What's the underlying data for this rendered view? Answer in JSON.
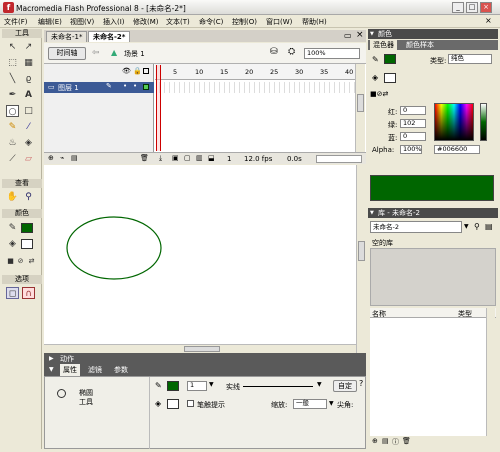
{
  "window": {
    "title": "Macromedia Flash Professional 8 - [未命名-2*]"
  },
  "menu": [
    "文件(F)",
    "编辑(E)",
    "视图(V)",
    "插入(I)",
    "修改(M)",
    "文本(T)",
    "命令(C)",
    "控制(O)",
    "窗口(W)",
    "帮助(H)"
  ],
  "toolbox": {
    "title": "工具",
    "view_label": "查看",
    "color_label": "颜色",
    "options_label": "选项"
  },
  "tabs": [
    "未命名-1*",
    "未命名-2*"
  ],
  "scene": {
    "timeline_button": "时间轴",
    "scene_label": "场景 1",
    "zoom": "100%"
  },
  "timeline": {
    "layer_name": "图层 1",
    "frame_numbers": [
      "5",
      "10",
      "15",
      "20",
      "25",
      "30",
      "35",
      "40"
    ],
    "current_frame": "1",
    "fps": "12.0 fps",
    "elapsed": "0.0s"
  },
  "actions_panel": {
    "title": "动作"
  },
  "properties": {
    "tabs": [
      "属性",
      "滤镜",
      "参数"
    ],
    "tool_name": "椭圆",
    "tool_label": "工具",
    "stroke_width": "1",
    "stroke_style": "实线",
    "custom_button": "自定",
    "hint_label": "笔触提示",
    "scale_label": "缩放:",
    "scale_value": "一般",
    "cap_label": "尖角:"
  },
  "color_panel": {
    "title": "颜色",
    "tabs": [
      "混色器",
      "颜色样本"
    ],
    "type_label": "类型:",
    "type_value": "纯色",
    "red_label": "红:",
    "red_value": "0",
    "green_label": "绿:",
    "green_value": "102",
    "blue_label": "蓝:",
    "blue_value": "0",
    "alpha_label": "Alpha:",
    "alpha_value": "100%",
    "hex_value": "#006600",
    "swatch_color": "#006600"
  },
  "library_panel": {
    "title": "库 - 未命名-2",
    "doc_select": "未命名-2",
    "empty_label": "空的库",
    "col_name": "名称",
    "col_type": "类型"
  },
  "stage": {
    "ellipse_stroke": "#006600"
  }
}
